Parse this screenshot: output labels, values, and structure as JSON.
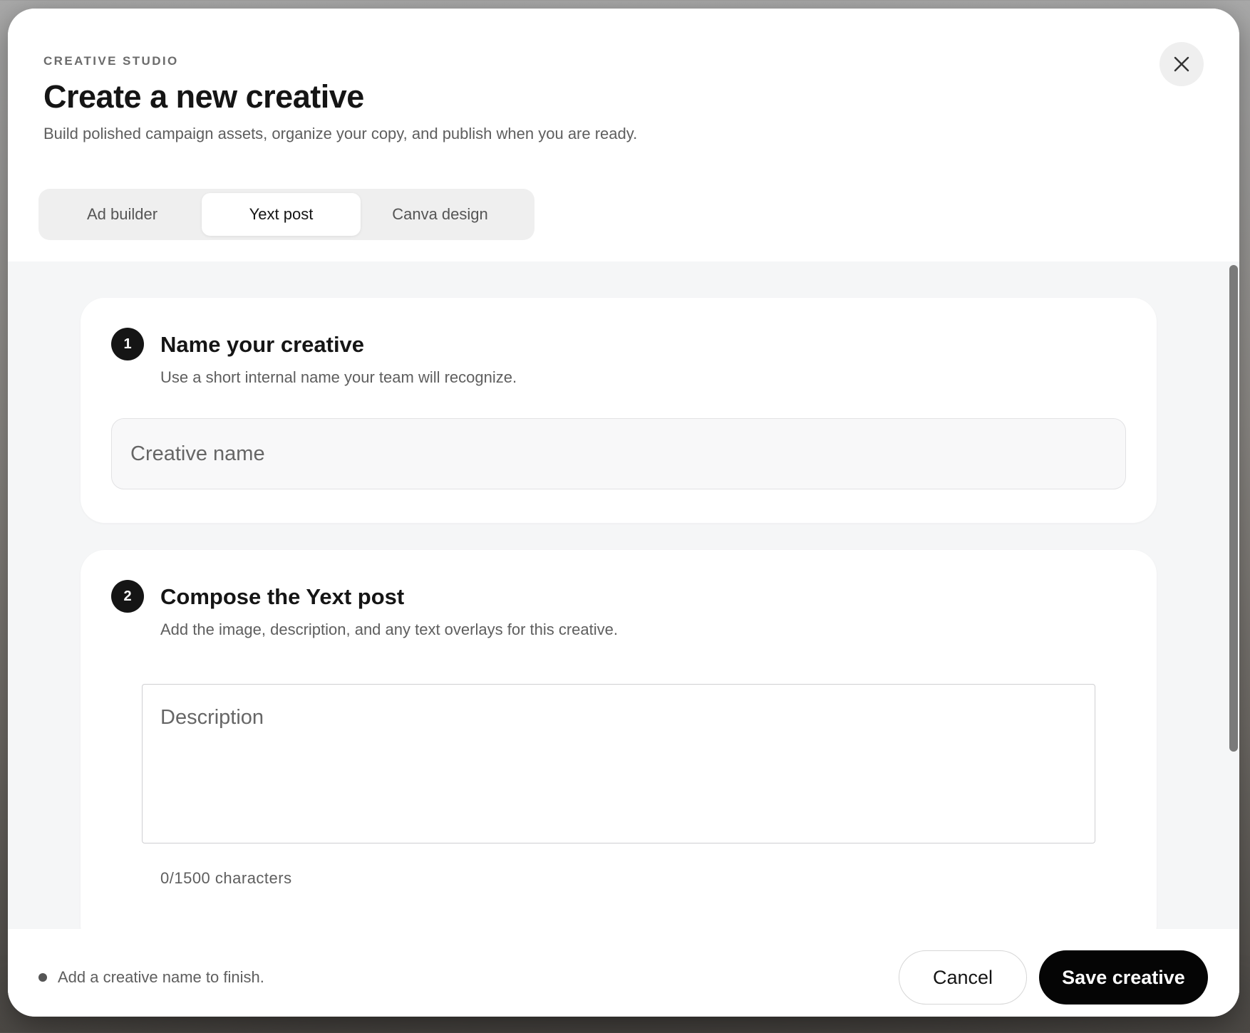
{
  "header": {
    "eyebrow": "CREATIVE STUDIO",
    "title": "Create a new creative",
    "subtitle": "Build polished campaign assets, organize your copy, and publish when you are ready.",
    "close_icon": "close-icon"
  },
  "tabs": [
    {
      "label": "Ad builder",
      "active": false
    },
    {
      "label": "Yext post",
      "active": true
    },
    {
      "label": "Canva design",
      "active": false
    }
  ],
  "step1": {
    "number": "1",
    "title": "Name your creative",
    "description": "Use a short internal name your team will recognize.",
    "input_placeholder": "Creative name",
    "input_value": ""
  },
  "step2": {
    "number": "2",
    "title": "Compose the Yext post",
    "description": "Add the image, description, and any text overlays for this creative.",
    "textarea_placeholder": "Description",
    "textarea_value": "",
    "char_count": "0/1500 characters"
  },
  "footer": {
    "status": "Add a creative name to finish.",
    "cancel_label": "Cancel",
    "save_label": "Save creative"
  },
  "colors": {
    "primary_button": "#050505",
    "surface": "#f5f6f7",
    "text_primary": "#151515",
    "text_secondary": "#5e5e5e"
  }
}
